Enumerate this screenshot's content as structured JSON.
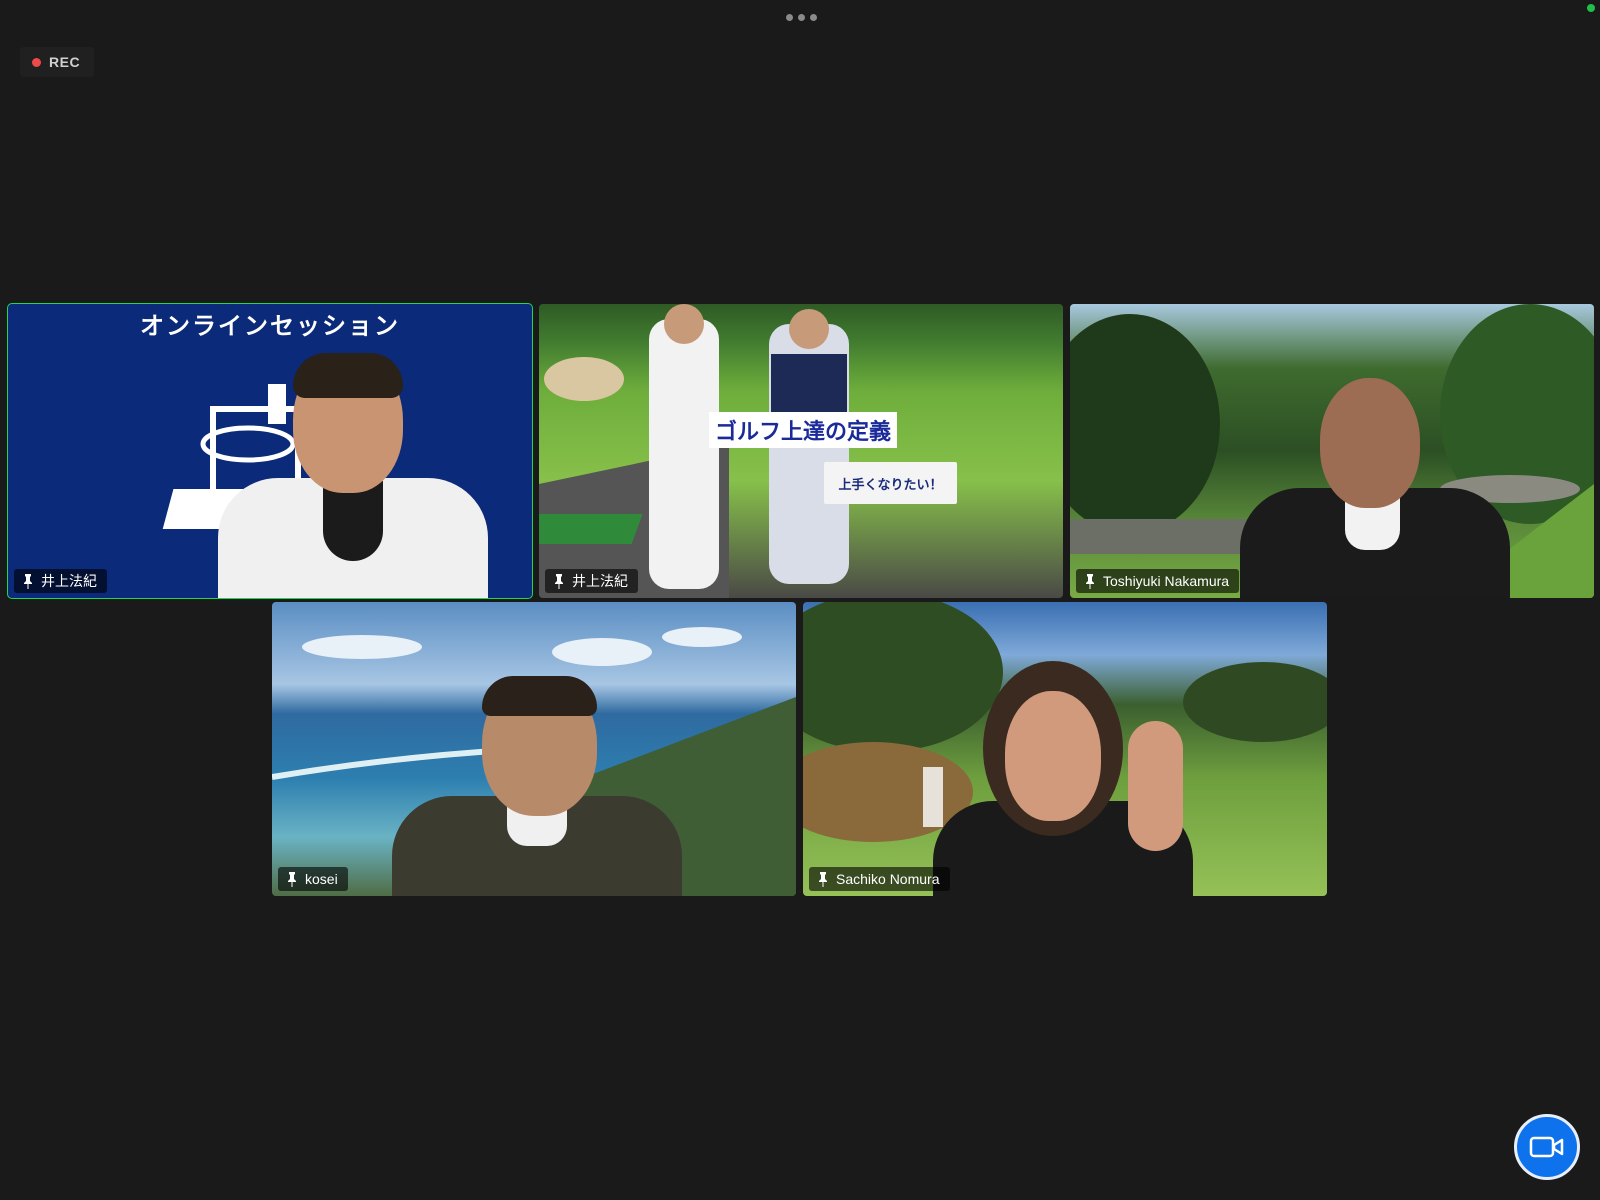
{
  "recording": {
    "label": "REC"
  },
  "participants": [
    {
      "name": "井上法紀",
      "background_title": "オンラインセッション",
      "active_speaker": true
    },
    {
      "name": "井上法紀",
      "overlay_title": "ゴルフ上達の定義",
      "overlay_bubble": "上手くなりたい！"
    },
    {
      "name": "Toshiyuki Nakamura"
    },
    {
      "name": "kosei"
    },
    {
      "name": "Sachiko Nomura"
    }
  ],
  "icons": {
    "more": "more-options-icon",
    "pin": "pin-icon",
    "camera": "video-camera-icon"
  },
  "colors": {
    "active_speaker_border": "#22d655",
    "record_dot": "#ef4a4a",
    "camera_button": "#0e72ed"
  }
}
